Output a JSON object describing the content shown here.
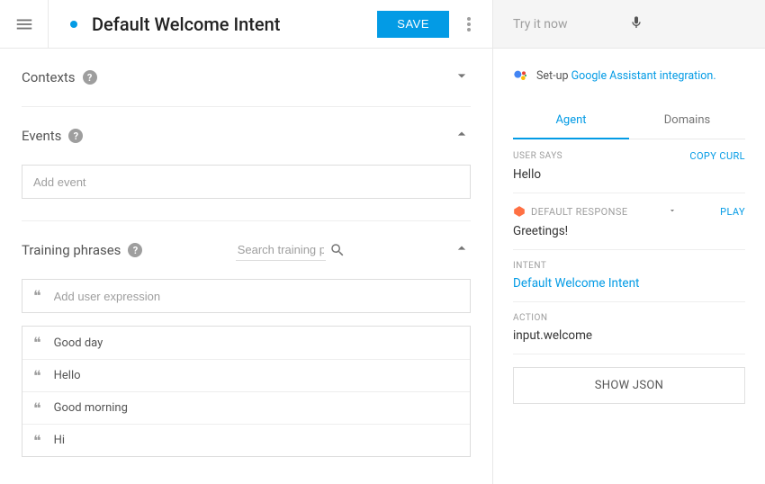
{
  "header": {
    "title": "Default Welcome Intent",
    "save_label": "SAVE"
  },
  "sections": {
    "contexts_label": "Contexts",
    "events_label": "Events",
    "events_placeholder": "Add event",
    "training_label": "Training phrases",
    "search_placeholder": "Search training phrases",
    "add_expr_placeholder": "Add user expression",
    "phrases": [
      "Good day",
      "Hello",
      "Good morning",
      "Hi"
    ]
  },
  "side": {
    "try_label": "Try it now",
    "setup_prefix": "Set-up ",
    "setup_link": "Google Assistant integration.",
    "tabs": {
      "agent": "Agent",
      "domains": "Domains"
    },
    "user_says_label": "USER SAYS",
    "copy_curl": "COPY CURL",
    "user_says_val": "Hello",
    "default_response_label": "DEFAULT RESPONSE",
    "play_label": "PLAY",
    "response_val": "Greetings!",
    "intent_label": "INTENT",
    "intent_val": "Default Welcome Intent",
    "action_label": "ACTION",
    "action_val": "input.welcome",
    "show_json": "SHOW JSON"
  }
}
